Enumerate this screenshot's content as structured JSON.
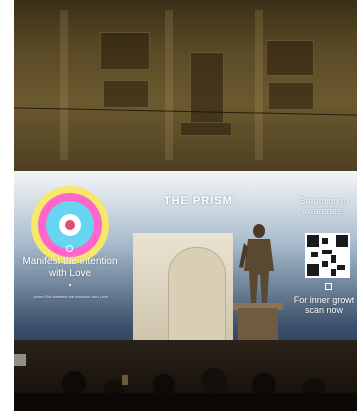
{
  "projection": {
    "title": "THE PRISM",
    "title_mark": "°",
    "breathing_text": "Breathing to awareness",
    "manifest_text": "Manifest the intention with Love",
    "small_caption": "prism Elle Manifest the intention with Love",
    "inner_growth_text": "For inner growt scan now"
  },
  "colors": {
    "ring_outer": "#f5e86b",
    "ring_mid": "#ff66cc",
    "ring_inner": "#66d6f0",
    "ring_core": "#ffffff",
    "dot": "#e44b74"
  },
  "icons": [
    "qr-code-icon",
    "target-rings-icon",
    "statue-icon"
  ]
}
